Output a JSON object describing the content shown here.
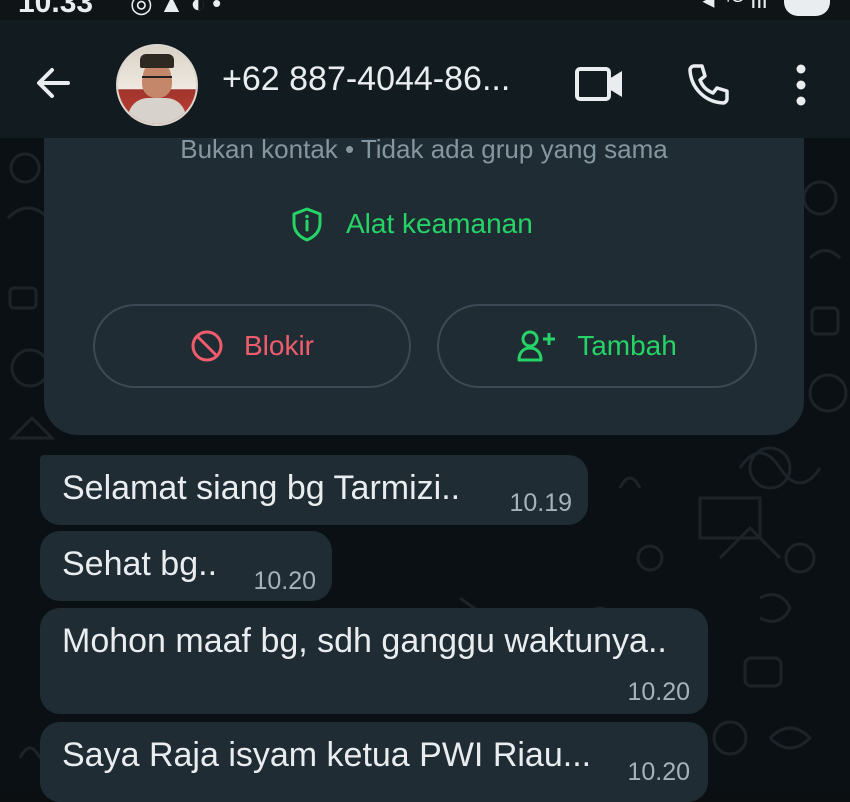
{
  "status_bar": {
    "time": "10.33",
    "battery": "85"
  },
  "header": {
    "contact_name": "+62 887-4044-86...",
    "icons": [
      "back-arrow-icon",
      "video-call-icon",
      "phone-icon",
      "more-vert-icon"
    ]
  },
  "info_card": {
    "info_text": "Bukan kontak • Tidak ada grup yang sama",
    "security_label": "Alat keamanan",
    "block_label": "Blokir",
    "add_label": "Tambah"
  },
  "messages": [
    {
      "text": "Selamat siang bg Tarmizi..",
      "time": "10.19"
    },
    {
      "text": "Sehat bg..",
      "time": "10.20"
    },
    {
      "text": "Mohon maaf bg, sdh ganggu waktunya..",
      "time": "10.20"
    },
    {
      "text": "Saya Raja isyam ketua PWI Riau...",
      "time": "10.20"
    }
  ],
  "colors": {
    "accent_green": "#25d366",
    "danger_red": "#f15c6d",
    "bubble": "#1f2c34",
    "header": "#121b20"
  }
}
